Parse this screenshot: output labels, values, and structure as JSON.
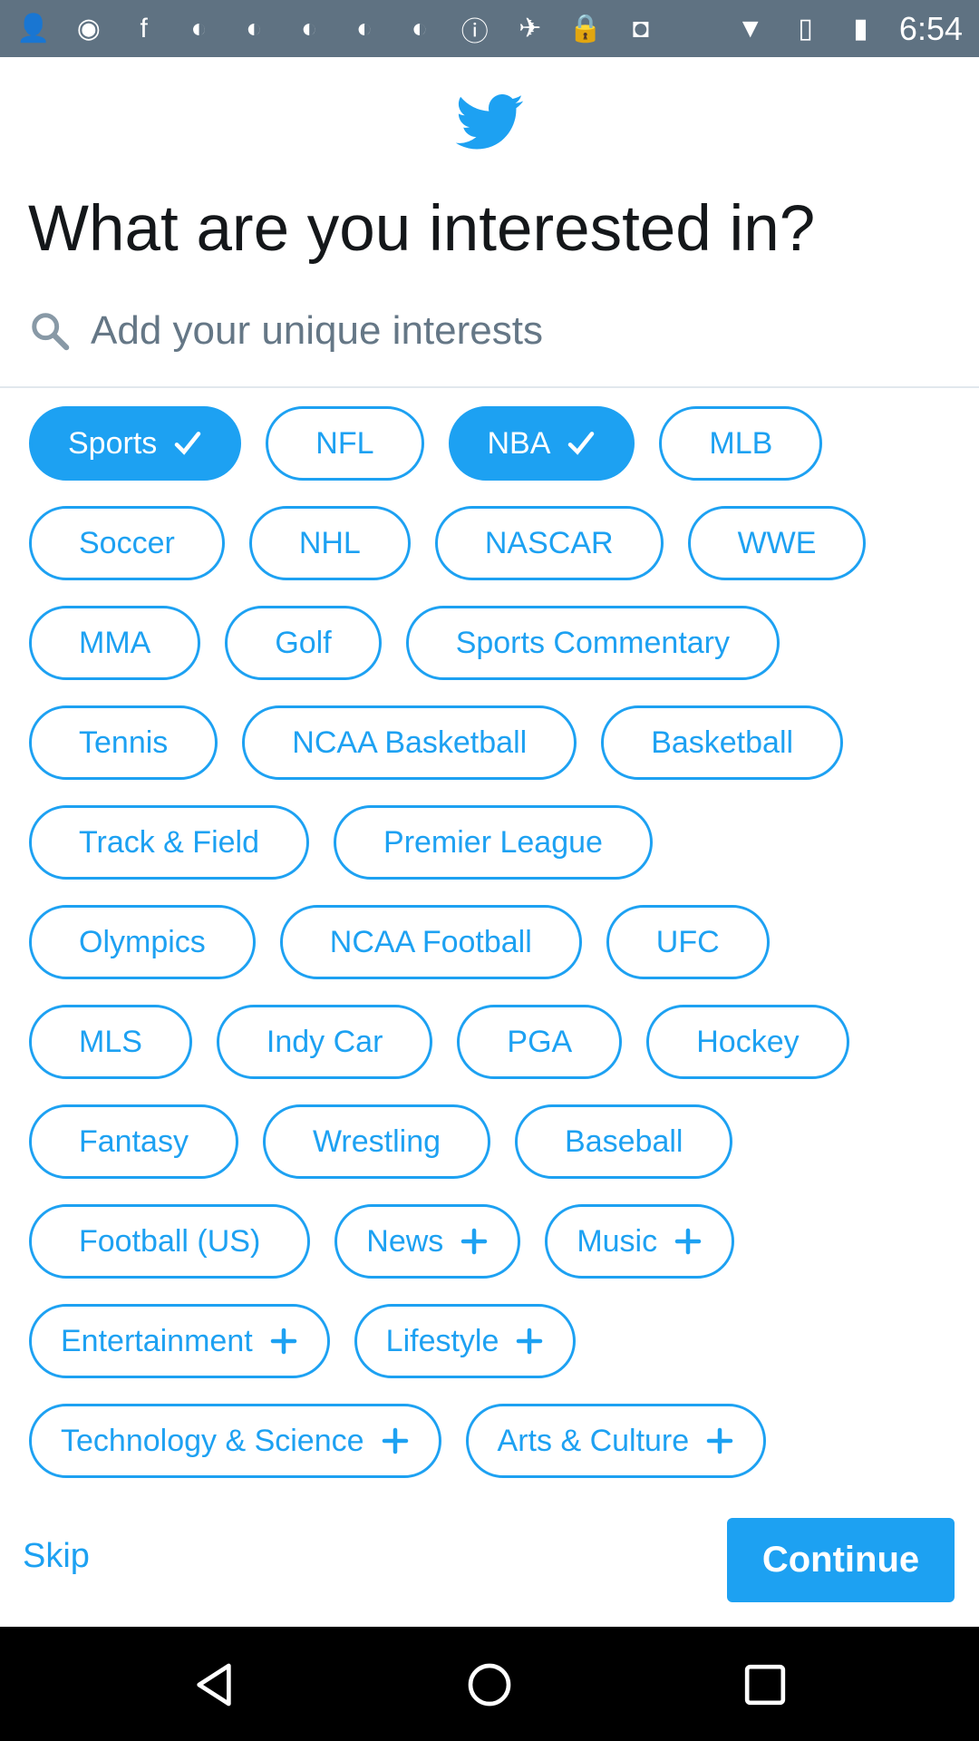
{
  "status_bar": {
    "time": "6:54",
    "icons": [
      "add-user-icon",
      "abc6-icon",
      "facebook-icon",
      "abc7-icon",
      "abc7-icon",
      "abc7-icon",
      "abc7-icon",
      "abc7-icon",
      "info-icon",
      "fake-gps-icon",
      "lock-icon",
      "android-icon",
      "wifi-icon",
      "no-sim-icon",
      "battery-charging-icon"
    ]
  },
  "header": {
    "title": "What are you interested in?"
  },
  "search": {
    "placeholder": "Add your unique interests",
    "value": ""
  },
  "colors": {
    "accent": "#1da1f2",
    "status_bar": "#5f7282"
  },
  "interest_rows": [
    [
      {
        "label": "Sports",
        "state": "selected"
      },
      {
        "label": "NFL",
        "state": "none"
      },
      {
        "label": "NBA",
        "state": "selected"
      },
      {
        "label": "MLB",
        "state": "none"
      }
    ],
    [
      {
        "label": "Soccer",
        "state": "none"
      },
      {
        "label": "NHL",
        "state": "none"
      },
      {
        "label": "NASCAR",
        "state": "none"
      },
      {
        "label": "WWE",
        "state": "none"
      }
    ],
    [
      {
        "label": "MMA",
        "state": "none"
      },
      {
        "label": "Golf",
        "state": "none"
      },
      {
        "label": "Sports Commentary",
        "state": "none"
      }
    ],
    [
      {
        "label": "Tennis",
        "state": "none"
      },
      {
        "label": "NCAA Basketball",
        "state": "none"
      },
      {
        "label": "Basketball",
        "state": "none"
      }
    ],
    [
      {
        "label": "Track & Field",
        "state": "none"
      },
      {
        "label": "Premier League",
        "state": "none"
      }
    ],
    [
      {
        "label": "Olympics",
        "state": "none"
      },
      {
        "label": "NCAA Football",
        "state": "none"
      },
      {
        "label": "UFC",
        "state": "none"
      }
    ],
    [
      {
        "label": "MLS",
        "state": "none"
      },
      {
        "label": "Indy Car",
        "state": "none"
      },
      {
        "label": "PGA",
        "state": "none"
      },
      {
        "label": "Hockey",
        "state": "none"
      }
    ],
    [
      {
        "label": "Fantasy",
        "state": "none"
      },
      {
        "label": "Wrestling",
        "state": "none"
      },
      {
        "label": "Baseball",
        "state": "none"
      }
    ],
    [
      {
        "label": "Football (US)",
        "state": "none"
      },
      {
        "label": "News",
        "state": "add"
      },
      {
        "label": "Music",
        "state": "add"
      }
    ],
    [
      {
        "label": "Entertainment",
        "state": "add"
      },
      {
        "label": "Lifestyle",
        "state": "add"
      }
    ],
    [
      {
        "label": "Technology & Science",
        "state": "add"
      },
      {
        "label": "Arts & Culture",
        "state": "add"
      }
    ]
  ],
  "footer": {
    "skip": "Skip",
    "continue": "Continue"
  },
  "nav": {
    "icons": [
      "back-icon",
      "home-icon",
      "recents-icon"
    ]
  }
}
